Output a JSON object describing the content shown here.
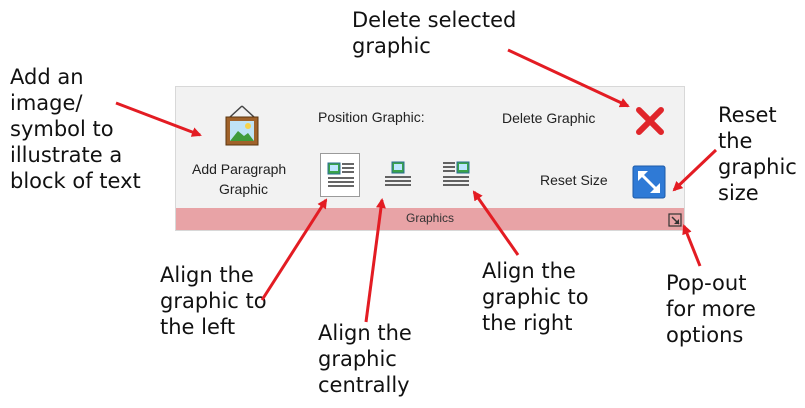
{
  "annotations": {
    "delete_line1": "Delete selected",
    "delete_line2": "graphic",
    "add_line1": "Add an",
    "add_line2": "image/",
    "add_line3": "symbol to",
    "add_line4": "illustrate a",
    "add_line5": "block of text",
    "reset_line1": "Reset",
    "reset_line2": "the",
    "reset_line3": "graphic",
    "reset_line4": "size",
    "left_line1": "Align the",
    "left_line2": "graphic to",
    "left_line3": "the left",
    "center_line1": "Align the",
    "center_line2": "graphic",
    "center_line3": "centrally",
    "right_line1": "Align the",
    "right_line2": "graphic to",
    "right_line3": "the right",
    "popout_line1": "Pop-out",
    "popout_line2": "for more",
    "popout_line3": "options"
  },
  "ribbon": {
    "add_paragraph_line1": "Add Paragraph",
    "add_paragraph_line2": "Graphic",
    "position_graphic_label": "Position Graphic:",
    "delete_graphic_label": "Delete Graphic",
    "reset_size_label": "Reset Size",
    "group_label": "Graphics",
    "selected_alignment": "left"
  },
  "icons": {
    "add_paragraph": "framed-picture-icon",
    "delete": "red-x-icon",
    "reset_size": "resize-arrows-icon",
    "align_left": "align-left-icon",
    "align_center": "align-center-icon",
    "align_right": "align-right-icon",
    "popout": "dialog-launcher-icon"
  },
  "colors": {
    "accent_arrow": "#e31c23",
    "group_bar": "#e8a3a6",
    "delete_x": "#e0262b",
    "reset_blue": "#2f7ad6"
  }
}
